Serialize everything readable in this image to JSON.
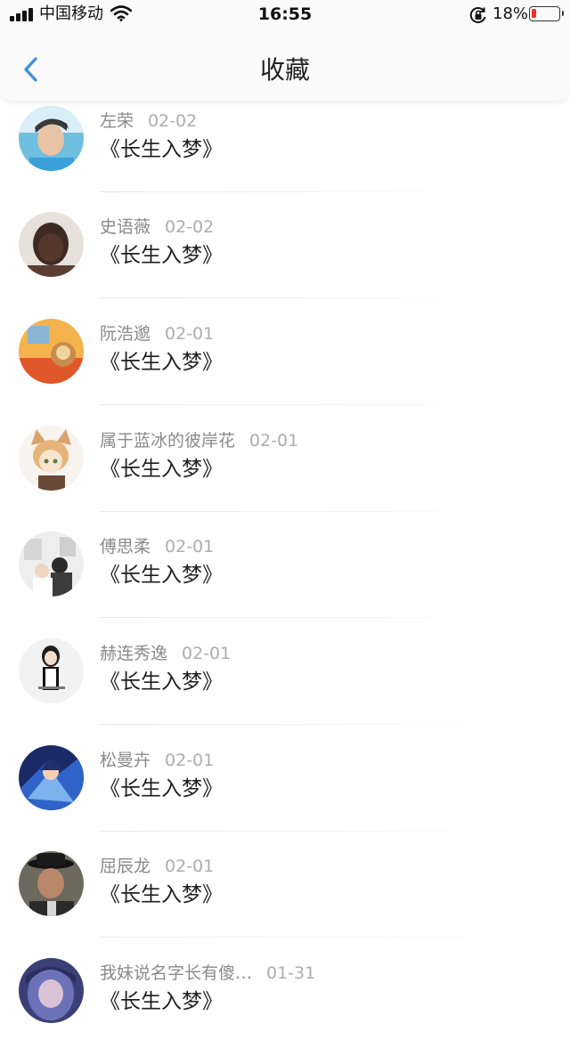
{
  "status_bar": {
    "carrier": "中国移动",
    "time": "16:55",
    "battery": "18%",
    "battery_level": 0.18,
    "icons": [
      "signal-icon",
      "wifi-icon",
      "rotation-lock-icon",
      "battery-icon"
    ]
  },
  "nav": {
    "title": "收藏",
    "back_icon": "chevron-left-icon",
    "accent_color": "#3d8fe0"
  },
  "favorites": [
    {
      "author": "左荣",
      "date": "02-02",
      "book": "《长生入梦》"
    },
    {
      "author": "史语薇",
      "date": "02-02",
      "book": "《长生入梦》"
    },
    {
      "author": "阮浩邈",
      "date": "02-01",
      "book": "《长生入梦》"
    },
    {
      "author": "属于蓝冰的彼岸花",
      "date": "02-01",
      "book": "《长生入梦》"
    },
    {
      "author": "傅思柔",
      "date": "02-01",
      "book": "《长生入梦》"
    },
    {
      "author": "赫连秀逸",
      "date": "02-01",
      "book": "《长生入梦》"
    },
    {
      "author": "松曼卉",
      "date": "02-01",
      "book": "《长生入梦》"
    },
    {
      "author": "屈辰龙",
      "date": "02-01",
      "book": "《长生入梦》"
    },
    {
      "author": "我妹说名字长有傻…",
      "date": "01-31",
      "book": "《长生入梦》"
    }
  ]
}
